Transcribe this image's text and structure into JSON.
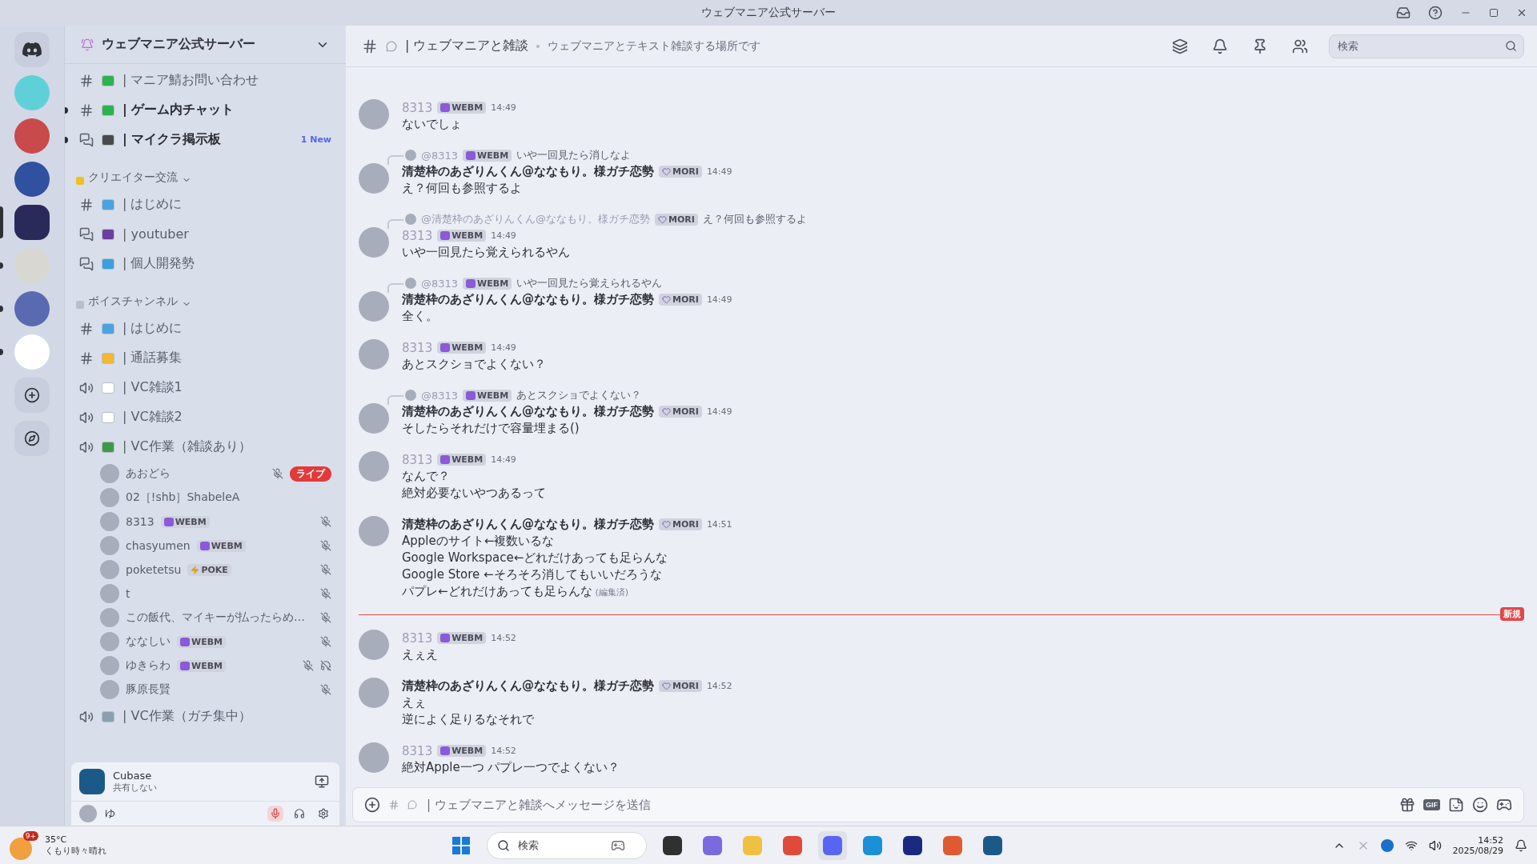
{
  "window": {
    "title": "ウェブマニア公式サーバー"
  },
  "servers": [
    {
      "selected": false,
      "unread": false,
      "color": "#5fd0d8"
    },
    {
      "selected": false,
      "unread": false,
      "color": "#c84a4a"
    },
    {
      "selected": false,
      "unread": false,
      "color": "#3050a0"
    },
    {
      "selected": true,
      "color": "#2a2a5a"
    },
    {
      "selected": false,
      "unread": true,
      "color": "#d8d8d0"
    },
    {
      "selected": false,
      "unread": true,
      "color": "#5a6ab0"
    },
    {
      "selected": false,
      "unread": true,
      "color": "#ffffff"
    }
  ],
  "server": {
    "name": "ウェブマニア公式サーバー"
  },
  "sidebar": {
    "items": [
      {
        "kind": "text",
        "color": "#2eb24f",
        "name": "| マニア鯖お問い合わせ",
        "unread": false
      },
      {
        "kind": "text",
        "color": "#2eb24f",
        "name": "| ゲーム内チャット",
        "unread": true
      },
      {
        "kind": "forum",
        "color": "#4a4a4a",
        "name": "| マイクラ掲示板",
        "unread": true,
        "badge": "1 New"
      },
      {
        "kind": "category",
        "color": "#f0c020",
        "name": "クリエイター交流"
      },
      {
        "kind": "text",
        "color": "#4aa3df",
        "name": "| はじめに",
        "unread": false
      },
      {
        "kind": "forum",
        "color": "#6b3fa0",
        "name": "| youtuber",
        "unread": false
      },
      {
        "kind": "forum",
        "color": "#3aa0e0",
        "name": "| 個人開発勢",
        "unread": false
      },
      {
        "kind": "category",
        "color": "#b8c0cc",
        "name": "ボイスチャンネル"
      },
      {
        "kind": "text",
        "color": "#4aa3df",
        "name": "| はじめに",
        "unread": false
      },
      {
        "kind": "text",
        "color": "#f5b830",
        "name": "| 通話募集",
        "unread": false
      },
      {
        "kind": "voice",
        "color": "#ffffff",
        "name": "| VC雑談1",
        "unread": false
      },
      {
        "kind": "voice",
        "color": "#ffffff",
        "name": "| VC雑談2",
        "unread": false
      },
      {
        "kind": "voice",
        "color": "#3c9a4a",
        "name": "| VC作業（雑談あり）",
        "unread": false,
        "children": [
          {
            "name": "あおどら",
            "muted": true,
            "deafened": false,
            "live": "ライブ"
          },
          {
            "name": "02［!shb］ShabeleA",
            "muted": false,
            "deafened": false
          },
          {
            "name": "8313",
            "tag": {
              "kind": "webm",
              "text": "WEBM"
            },
            "muted": true,
            "deafened": false
          },
          {
            "name": "chasyumen",
            "tag": {
              "kind": "webm",
              "text": "WEBM"
            },
            "muted": true,
            "deafened": false
          },
          {
            "name": "poketetsu",
            "tag": {
              "kind": "poke",
              "text": "POKE"
            },
            "muted": true,
            "deafened": false
          },
          {
            "name": "t",
            "muted": true,
            "deafened": false
          },
          {
            "name": "この飯代、マイキーが払ったらめ…",
            "muted": true,
            "deafened": false
          },
          {
            "name": "ななしい",
            "tag": {
              "kind": "webm",
              "text": "WEBM"
            },
            "muted": true,
            "deafened": false
          },
          {
            "name": "ゆきらわ",
            "tag": {
              "kind": "webm",
              "text": "WEBM"
            },
            "muted": true,
            "deafened": true
          },
          {
            "name": "豚原長賢",
            "muted": true,
            "deafened": false
          }
        ]
      },
      {
        "kind": "voice",
        "color": "#8aa0b0",
        "name": "| VC作業（ガチ集中）",
        "unread": false
      }
    ]
  },
  "activity": {
    "app": "Cubase",
    "status": "共有しない"
  },
  "user_panel": {
    "name": "ゆ"
  },
  "header": {
    "channel": "| ウェブマニアと雑談",
    "topic": "ウェブマニアとテキスト雑談する場所です",
    "search_placeholder": "検索"
  },
  "messages": [
    {
      "kind": "message",
      "author": "8313",
      "color": "#a09cb8",
      "tag": {
        "kind": "webm",
        "text": "WEBM"
      },
      "time": "14:49",
      "lines": [
        "ないでしょ"
      ]
    },
    {
      "kind": "message",
      "author": "清楚枠のあざりんくん@ななもり。様ガチ恋勢",
      "color": "#2e3038",
      "tag": {
        "kind": "mori",
        "text": "MORI"
      },
      "time": "14:49",
      "reply": {
        "author": "@8313",
        "tag": {
          "kind": "webm",
          "text": "WEBM"
        },
        "text": "いや一回見たら消しなよ"
      },
      "lines": [
        "え？何回も参照するよ"
      ]
    },
    {
      "kind": "message",
      "author": "8313",
      "color": "#a09cb8",
      "tag": {
        "kind": "webm",
        "text": "WEBM"
      },
      "time": "14:49",
      "reply": {
        "author": "@清楚枠のあざりんくん@ななもり。様ガチ恋勢",
        "tag": {
          "kind": "mori",
          "text": "MORI"
        },
        "text": "え？何回も参照するよ"
      },
      "lines": [
        "いや一回見たら覚えられるやん"
      ]
    },
    {
      "kind": "message",
      "author": "清楚枠のあざりんくん@ななもり。様ガチ恋勢",
      "color": "#2e3038",
      "tag": {
        "kind": "mori",
        "text": "MORI"
      },
      "time": "14:49",
      "reply": {
        "author": "@8313",
        "tag": {
          "kind": "webm",
          "text": "WEBM"
        },
        "text": "いや一回見たら覚えられるやん"
      },
      "lines": [
        "全く。"
      ]
    },
    {
      "kind": "message",
      "author": "8313",
      "color": "#a09cb8",
      "tag": {
        "kind": "webm",
        "text": "WEBM"
      },
      "time": "14:49",
      "lines": [
        "あとスクショでよくない？"
      ]
    },
    {
      "kind": "message",
      "author": "清楚枠のあざりんくん@ななもり。様ガチ恋勢",
      "color": "#2e3038",
      "tag": {
        "kind": "mori",
        "text": "MORI"
      },
      "time": "14:49",
      "reply": {
        "author": "@8313",
        "tag": {
          "kind": "webm",
          "text": "WEBM"
        },
        "text": "あとスクショでよくない？"
      },
      "lines": [
        "そしたらそれだけで容量埋まる()"
      ]
    },
    {
      "kind": "message",
      "author": "8313",
      "color": "#a09cb8",
      "tag": {
        "kind": "webm",
        "text": "WEBM"
      },
      "time": "14:49",
      "lines": [
        "なんで？",
        "絶対必要ないやつあるって"
      ]
    },
    {
      "kind": "message",
      "author": "清楚枠のあざりんくん@ななもり。様ガチ恋勢",
      "color": "#2e3038",
      "tag": {
        "kind": "mori",
        "text": "MORI"
      },
      "time": "14:51",
      "lines": [
        "Appleのサイト←複数いるな",
        "Google Workspace←どれだけあっても足らんな",
        "Google Store ←そろそろ消してもいいだろうな",
        "パプレ←どれだけあっても足らんな"
      ],
      "edited": "(編集済)"
    },
    {
      "kind": "divider",
      "label": "新規"
    },
    {
      "kind": "message",
      "author": "8313",
      "color": "#a09cb8",
      "tag": {
        "kind": "webm",
        "text": "WEBM"
      },
      "time": "14:52",
      "lines": [
        "えぇえ"
      ]
    },
    {
      "kind": "message",
      "author": "清楚枠のあざりんくん@ななもり。様ガチ恋勢",
      "color": "#2e3038",
      "tag": {
        "kind": "mori",
        "text": "MORI"
      },
      "time": "14:52",
      "lines": [
        "えぇ",
        "逆によく足りるなそれで"
      ]
    },
    {
      "kind": "message",
      "author": "8313",
      "color": "#a09cb8",
      "tag": {
        "kind": "webm",
        "text": "WEBM"
      },
      "time": "14:52",
      "lines": [
        "絶対Apple一つ パプレ一つでよくない？"
      ]
    }
  ],
  "composer": {
    "placeholder": "| ウェブマニアと雑談へメッセージを送信",
    "gif": "GIF"
  },
  "taskbar": {
    "temperature": "35°C",
    "weather": "くもり時々晴れ",
    "weather_badge": "9+",
    "search_placeholder": "検索",
    "time": "14:52",
    "date": "2025/08/29"
  }
}
